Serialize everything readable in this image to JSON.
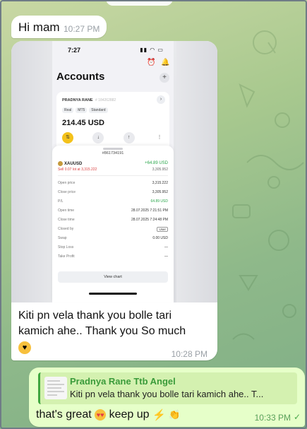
{
  "messages": {
    "hi": {
      "text": "Hi mam",
      "time": "10:27 PM"
    },
    "image_msg": {
      "caption": "Kiti pn vela thank you bolle tari kamich ahe.. Thank you So much",
      "emoji_name": "smiling-face-with-hearts",
      "time": "10:28 PM"
    },
    "outgoing": {
      "reply_name": "Pradnya Rane Ttb Angel",
      "reply_text": "Kiti pn vela thank you bolle tari kamich ahe.. T...",
      "text_before": "that's great",
      "text_middle": "keep up",
      "emojis": [
        "heart-eyes-face",
        "lightning-bolt",
        "clapping-hands"
      ],
      "time": "10:33 PM",
      "status": "read-check-icon"
    }
  },
  "screenshot": {
    "status_time": "7:27",
    "status_icons": "▮▮ ◠ ▭",
    "title": "Accounts",
    "plus": "+",
    "account": {
      "name": "PRADNYA RANE",
      "id": "# 184262882",
      "tags": [
        "Real",
        "MT5",
        "Standard"
      ],
      "balance": "214.45 USD"
    },
    "trade": {
      "ticket": "#861734191",
      "symbol": "XAUUSD",
      "pnl": "+64.89 USD",
      "sub_left": "Sell 0.07 lot at 3,315.222",
      "sub_right": "3,305.952",
      "rows": [
        {
          "label": "Open price",
          "value": "3,315.222"
        },
        {
          "label": "Close price",
          "value": "3,305.952"
        },
        {
          "label": "P/L",
          "value": "64.89 USD"
        },
        {
          "label": "Open time",
          "value": "28.07.2025 7:21:51 PM"
        },
        {
          "label": "Close time",
          "value": "28.07.2025 7:24:48 PM"
        },
        {
          "label": "Closed by",
          "value": "User"
        },
        {
          "label": "Swap",
          "value": "0.00 USD"
        },
        {
          "label": "Stop Loss",
          "value": "—"
        },
        {
          "label": "Take Profit",
          "value": "—"
        }
      ],
      "view_chart": "View chart"
    }
  },
  "colors": {
    "outgoing_bubble": "#e6ffc9",
    "incoming_bubble": "#ffffff",
    "reply_accent": "#3fa63f"
  }
}
